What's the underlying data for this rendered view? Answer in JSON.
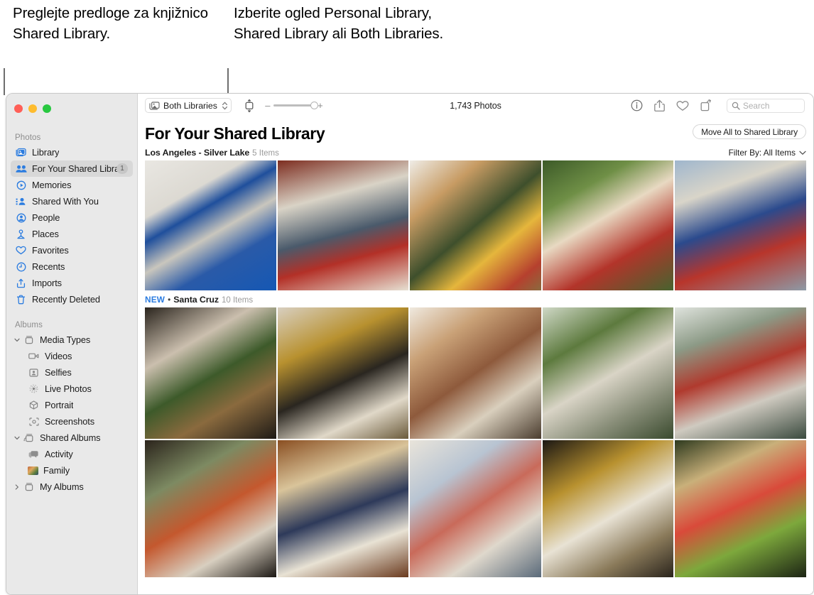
{
  "callouts": {
    "left": "Preglejte predloge za knjižnico Shared Library.",
    "right": "Izberite ogled Personal Library, Shared Library ali Both Libraries."
  },
  "window": {
    "traffic_lights": [
      "close",
      "minimize",
      "zoom"
    ]
  },
  "sidebar": {
    "sections": [
      {
        "title": "Photos",
        "items": [
          {
            "label": "Library",
            "icon": "library-icon",
            "selected": false,
            "badge": ""
          },
          {
            "label": "For Your Shared Library",
            "icon": "people-shared-icon",
            "selected": true,
            "badge": "1"
          },
          {
            "label": "Memories",
            "icon": "memories-icon",
            "selected": false,
            "badge": ""
          },
          {
            "label": "Shared With You",
            "icon": "shared-with-you-icon",
            "selected": false,
            "badge": ""
          },
          {
            "label": "People",
            "icon": "person-circle-icon",
            "selected": false,
            "badge": ""
          },
          {
            "label": "Places",
            "icon": "places-pin-icon",
            "selected": false,
            "badge": ""
          },
          {
            "label": "Favorites",
            "icon": "heart-icon",
            "selected": false,
            "badge": ""
          },
          {
            "label": "Recents",
            "icon": "clock-icon",
            "selected": false,
            "badge": ""
          },
          {
            "label": "Imports",
            "icon": "import-icon",
            "selected": false,
            "badge": ""
          },
          {
            "label": "Recently Deleted",
            "icon": "trash-icon",
            "selected": false,
            "badge": ""
          }
        ]
      },
      {
        "title": "Albums",
        "items": [
          {
            "label": "Media Types",
            "icon": "album-icon",
            "disclosure": "expanded",
            "indent": 0
          },
          {
            "label": "Videos",
            "icon": "video-icon",
            "indent": 1
          },
          {
            "label": "Selfies",
            "icon": "selfie-icon",
            "indent": 1
          },
          {
            "label": "Live Photos",
            "icon": "live-photo-icon",
            "indent": 1
          },
          {
            "label": "Portrait",
            "icon": "portrait-icon",
            "indent": 1
          },
          {
            "label": "Screenshots",
            "icon": "screenshot-icon",
            "indent": 1
          },
          {
            "label": "Shared Albums",
            "icon": "shared-album-icon",
            "disclosure": "expanded",
            "indent": 0
          },
          {
            "label": "Activity",
            "icon": "activity-icon",
            "indent": 1
          },
          {
            "label": "Family",
            "icon": "family-album-thumbnail",
            "indent": 1
          },
          {
            "label": "My Albums",
            "icon": "album-icon",
            "disclosure": "collapsed",
            "indent": 0
          }
        ]
      }
    ]
  },
  "toolbar": {
    "library_picker": {
      "label": "Both Libraries",
      "icon": "library-stack-icon",
      "chevron": "chevron-up-down-icon",
      "options": [
        "Personal Library",
        "Shared Library",
        "Both Libraries"
      ]
    },
    "aspect_button_icon": "aspect-ratio-icon",
    "zoom": {
      "minus": "–",
      "plus": "+",
      "value_percent": 92
    },
    "photo_count": "1,743 Photos",
    "actions": [
      {
        "name": "info-button",
        "icon": "info-circle-icon"
      },
      {
        "name": "share-button",
        "icon": "share-icon"
      },
      {
        "name": "favorite-button",
        "icon": "heart-icon"
      },
      {
        "name": "rotate-button",
        "icon": "rotate-icon"
      }
    ],
    "search": {
      "placeholder": "Search",
      "value": "",
      "icon": "search-icon"
    }
  },
  "content": {
    "title": "For Your Shared Library",
    "move_all_button": "Move All to Shared Library",
    "filter_by": {
      "label": "Filter By: All Items",
      "chevron": "chevron-down-icon"
    },
    "sections": [
      {
        "new_badge": "",
        "separator": "",
        "name": "Los Angeles - Silver Lake",
        "count": "5 Items",
        "photos": [
          "p1",
          "p2",
          "p3",
          "p4",
          "p5"
        ]
      },
      {
        "new_badge": "NEW",
        "separator": "•",
        "name": "Santa Cruz",
        "count": "10 Items",
        "photos_row1": [
          "q1",
          "q2",
          "q3",
          "q4",
          "q5"
        ],
        "photos_row2": [
          "r1",
          "r2",
          "r3",
          "r4",
          "r5"
        ]
      }
    ]
  },
  "colors": {
    "accent_blue": "#2b7ce0",
    "sidebar_bg": "#e9e9e9",
    "selected_row": "#d8d8d8",
    "muted_text": "#9b9b9b"
  }
}
